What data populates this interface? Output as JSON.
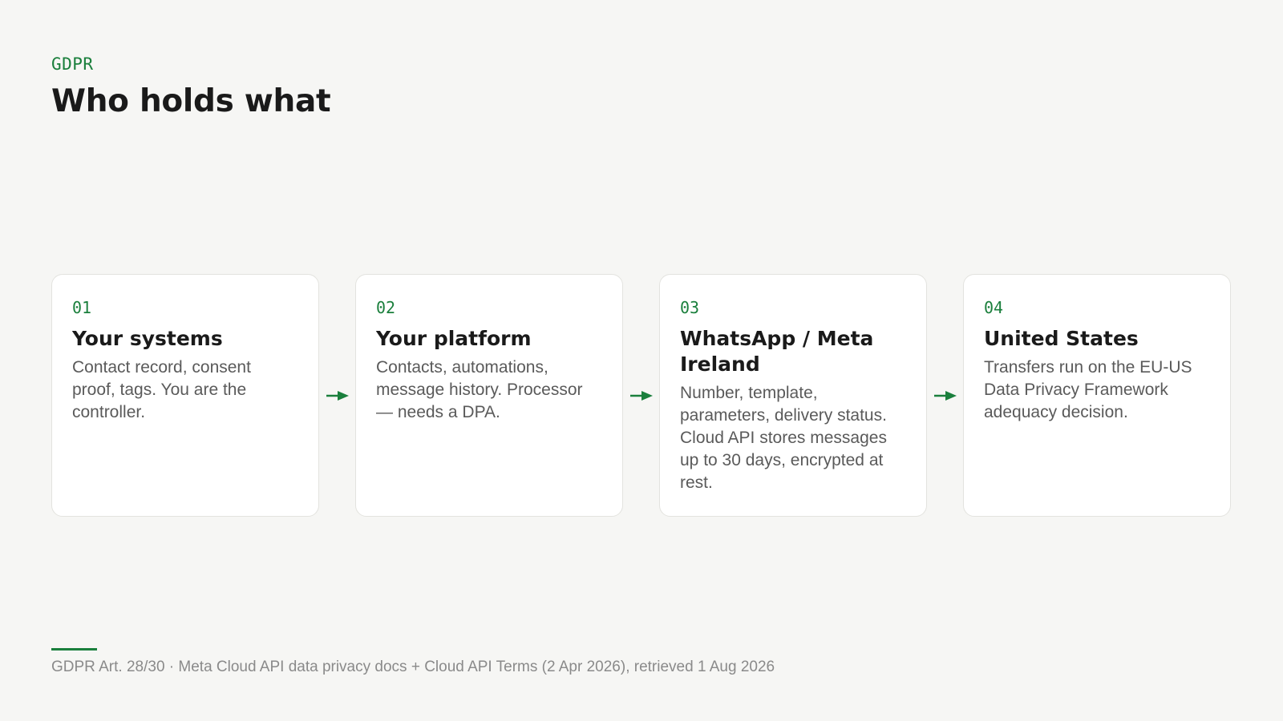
{
  "header": {
    "eyebrow": "GDPR",
    "title": "Who holds what"
  },
  "steps": [
    {
      "number": "01",
      "title": "Your systems",
      "text": "Contact record, consent proof, tags. You are the controller."
    },
    {
      "number": "02",
      "title": "Your platform",
      "text": "Contacts, automations, message history. Processor — needs a DPA."
    },
    {
      "number": "03",
      "title": "WhatsApp / Meta Ireland",
      "text": "Number, template, parameters, delivery status. Cloud API stores messages up to 30 days, encrypted at rest."
    },
    {
      "number": "04",
      "title": "United States",
      "text": "Transfers run on the EU-US Data Privacy Framework adequacy decision."
    }
  ],
  "footer": {
    "source": "GDPR Art. 28/30 · Meta Cloud API data privacy docs + Cloud API Terms (2 Apr 2026), retrieved 1 Aug 2026"
  },
  "colors": {
    "accent": "#1a7f3c",
    "background": "#f6f6f4",
    "card": "#ffffff",
    "muted_text": "#5a5a5a"
  },
  "icons": {
    "connector": "arrow-right-icon"
  }
}
